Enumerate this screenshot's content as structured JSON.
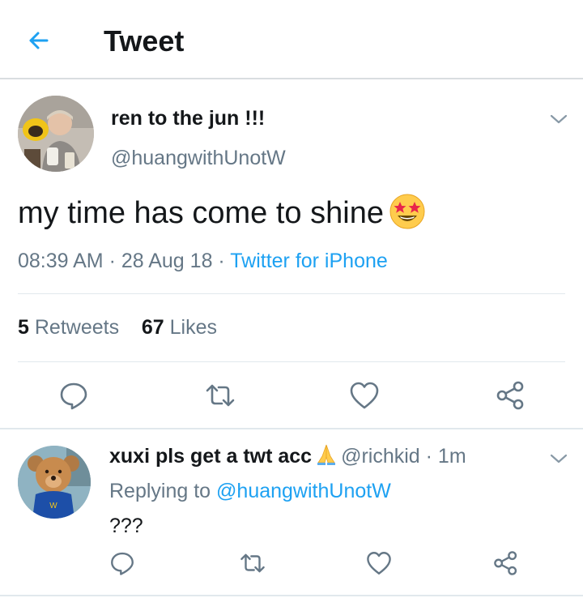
{
  "header": {
    "title": "Tweet"
  },
  "tweet": {
    "display_name": "ren to the jun !!!",
    "handle": "@huangwithUnotW",
    "text": "my time has come to shine",
    "emoji": "star-struck-emoji",
    "time": "08:39 AM",
    "sep1": " · ",
    "date": "28 Aug 18",
    "sep2": " · ",
    "source": "Twitter for iPhone",
    "retweets_count": "5",
    "retweets_label": "Retweets",
    "likes_count": "67",
    "likes_label": "Likes"
  },
  "reply": {
    "display_name": "xuxi pls get a twt acc",
    "emoji": "folded-hands-emoji",
    "handle_time": "@richkid · 1m",
    "replying_prefix": "Replying to",
    "replying_handle": "@huangwithUnotW",
    "text": "???"
  },
  "icons": {
    "back": "arrow-left-icon",
    "more": "chevron-down-icon",
    "reply": "speech-bubble-icon",
    "retweet": "retweet-icon",
    "like": "heart-icon",
    "share": "share-icon"
  },
  "colors": {
    "accent": "#1da1f2",
    "text": "#14171a",
    "muted": "#657786",
    "divider": "#e1e8ed"
  }
}
